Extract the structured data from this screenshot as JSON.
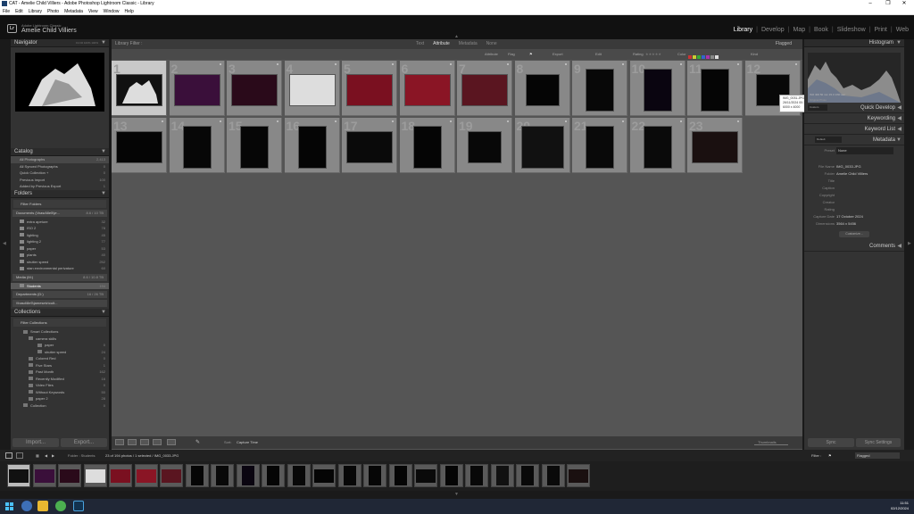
{
  "window": {
    "title": "CAT - Amelie Child Villiers - Adobe Photoshop Lightroom Classic - Library"
  },
  "menu": [
    "File",
    "Edit",
    "Library",
    "Photo",
    "Metadata",
    "View",
    "Window",
    "Help"
  ],
  "identity": {
    "app": "Adobe Lightroom Classic",
    "name": "Amelie Child Villiers"
  },
  "modules": [
    "Library",
    "Develop",
    "Map",
    "Book",
    "Slideshow",
    "Print",
    "Web"
  ],
  "active_module": "Library",
  "navigator": {
    "title": "Navigator",
    "zoom_options": "Fit  Fill  100%  100%"
  },
  "catalog": {
    "title": "Catalog",
    "items": [
      {
        "label": "All Photographs",
        "count": "2,413"
      },
      {
        "label": "All Synced Photographs",
        "count": "0"
      },
      {
        "label": "Quick Collection +",
        "count": "0"
      },
      {
        "label": "Previous Import",
        "count": "100"
      },
      {
        "label": "Added by Previous Export",
        "count": "1"
      }
    ]
  },
  "folders": {
    "title": "Folders",
    "filter": "Filter Folders",
    "volume": {
      "label": "Documents (\\\\hasd\\8e5\\je...",
      "info": "8.6 / 10 TB"
    },
    "items": [
      {
        "label": "extra apeture",
        "count": "32"
      },
      {
        "label": "ISO 2",
        "count": "78"
      },
      {
        "label": "lighting",
        "count": "45"
      },
      {
        "label": "lighting 2",
        "count": "77"
      },
      {
        "label": "paper",
        "count": "53"
      },
      {
        "label": "plants",
        "count": "40"
      },
      {
        "label": "shutter speed",
        "count": "252"
      },
      {
        "label": "stan environmental perivature",
        "count": "60"
      }
    ],
    "media": {
      "label": "Media (M:)",
      "info": "8.6 / 10.8 TB"
    },
    "students": {
      "label": "Students",
      "count": "194"
    },
    "departments": {
      "label": "Departments (D:)",
      "info": "16 / 26 TB"
    },
    "share": {
      "label": "\\\\hasd\\8e5\\jamesetv\\cult..."
    }
  },
  "collections": {
    "title": "Collections",
    "filter": "Filter Collections",
    "items": [
      {
        "label": "Smart Collections",
        "count": ""
      },
      {
        "label": "camera skills",
        "count": ""
      },
      {
        "label": "paper",
        "count": "0"
      },
      {
        "label": "shutter speed",
        "count": "24"
      },
      {
        "label": "Colored Red",
        "count": "0"
      },
      {
        "label": "Five Stars",
        "count": "1"
      },
      {
        "label": "Past Month",
        "count": "162"
      },
      {
        "label": "Recently Modified",
        "count": "16"
      },
      {
        "label": "Video Files",
        "count": "0"
      },
      {
        "label": "Without Keywords",
        "count": "50"
      },
      {
        "label": "paper 2",
        "count": "28"
      },
      {
        "label": "Collection",
        "count": "0"
      }
    ]
  },
  "buttons": {
    "import": "Import...",
    "export": "Export...",
    "sync": "Sync",
    "sync_settings": "Sync Settings"
  },
  "library_filter": {
    "label": "Library Filter :",
    "tabs": [
      "Text",
      "Attribute",
      "Metadata",
      "None"
    ],
    "active_tab": "Attribute",
    "preset": "Flagged",
    "attr_labels": [
      "Attribute",
      "Flag",
      "Rating",
      "Color",
      "Kind",
      "Edit",
      "Export"
    ]
  },
  "grid": {
    "row1_numbers": [
      "1",
      "2",
      "3",
      "4",
      "5",
      "6",
      "7",
      "8",
      "9",
      "10",
      "11",
      "12"
    ],
    "row2_numbers": [
      "13",
      "14",
      "15",
      "16",
      "17",
      "18",
      "19",
      "20",
      "21",
      "22",
      "23"
    ]
  },
  "tooltip": {
    "line1": "IMG_0031.JPG",
    "line2": "26/11/2024 00:12:13",
    "line3": "6000 x 4000"
  },
  "toolbar": {
    "sort_label": "Sort:",
    "sort_value": "Capture Time",
    "thumbnails": "Thumbnails"
  },
  "histogram": {
    "title": "Histogram",
    "info": "ISO 400   50 mm   f/2.0   1/60 sec",
    "original": "Original Photo"
  },
  "right_sections": {
    "quick_develop": "Quick Develop",
    "keywording": "Keywording",
    "keyword_list": "Keyword List",
    "metadata": "Metadata",
    "comments": "Comments",
    "preset_label": "Custom",
    "metadata_preset": "Default",
    "metadata_preset_label": "Preset",
    "preset_value": "None",
    "customize": "Customize..."
  },
  "metadata": [
    {
      "key": "File Name",
      "value": "IMG_0033.JPG"
    },
    {
      "key": "Folder",
      "value": "Amelie Child Villiers"
    },
    {
      "key": "Title",
      "value": ""
    },
    {
      "key": "Caption",
      "value": ""
    },
    {
      "key": "Copyright",
      "value": ""
    },
    {
      "key": "Creator",
      "value": ""
    },
    {
      "key": "Rating",
      "value": ""
    },
    {
      "key": "Capture Date",
      "value": "17 October 2024"
    },
    {
      "key": "Dimensions",
      "value": "3564 x 5456"
    }
  ],
  "filmbar": {
    "path": "Folder : Students",
    "count": "23 of 194 photos / 1 selected / IMG_0033.JPG",
    "filter_label": "Filter :",
    "filter_value": "Flagged"
  },
  "clock": {
    "time": "11:51",
    "date": "02/12/2024"
  }
}
